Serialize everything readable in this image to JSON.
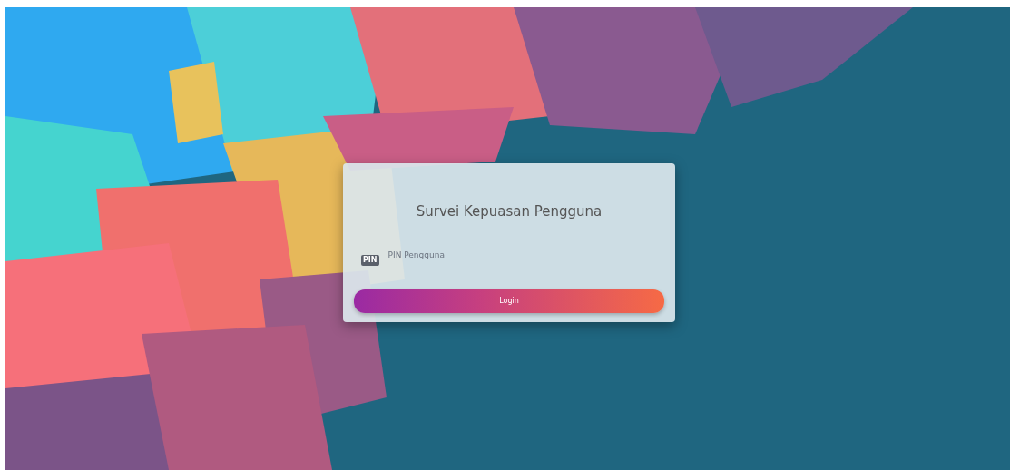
{
  "login_card": {
    "title": "Survei Kepuasan Pengguna",
    "pin_badge": "PIN",
    "pin_field": {
      "placeholder": "PIN Pengguna"
    },
    "login_button": "Login"
  }
}
